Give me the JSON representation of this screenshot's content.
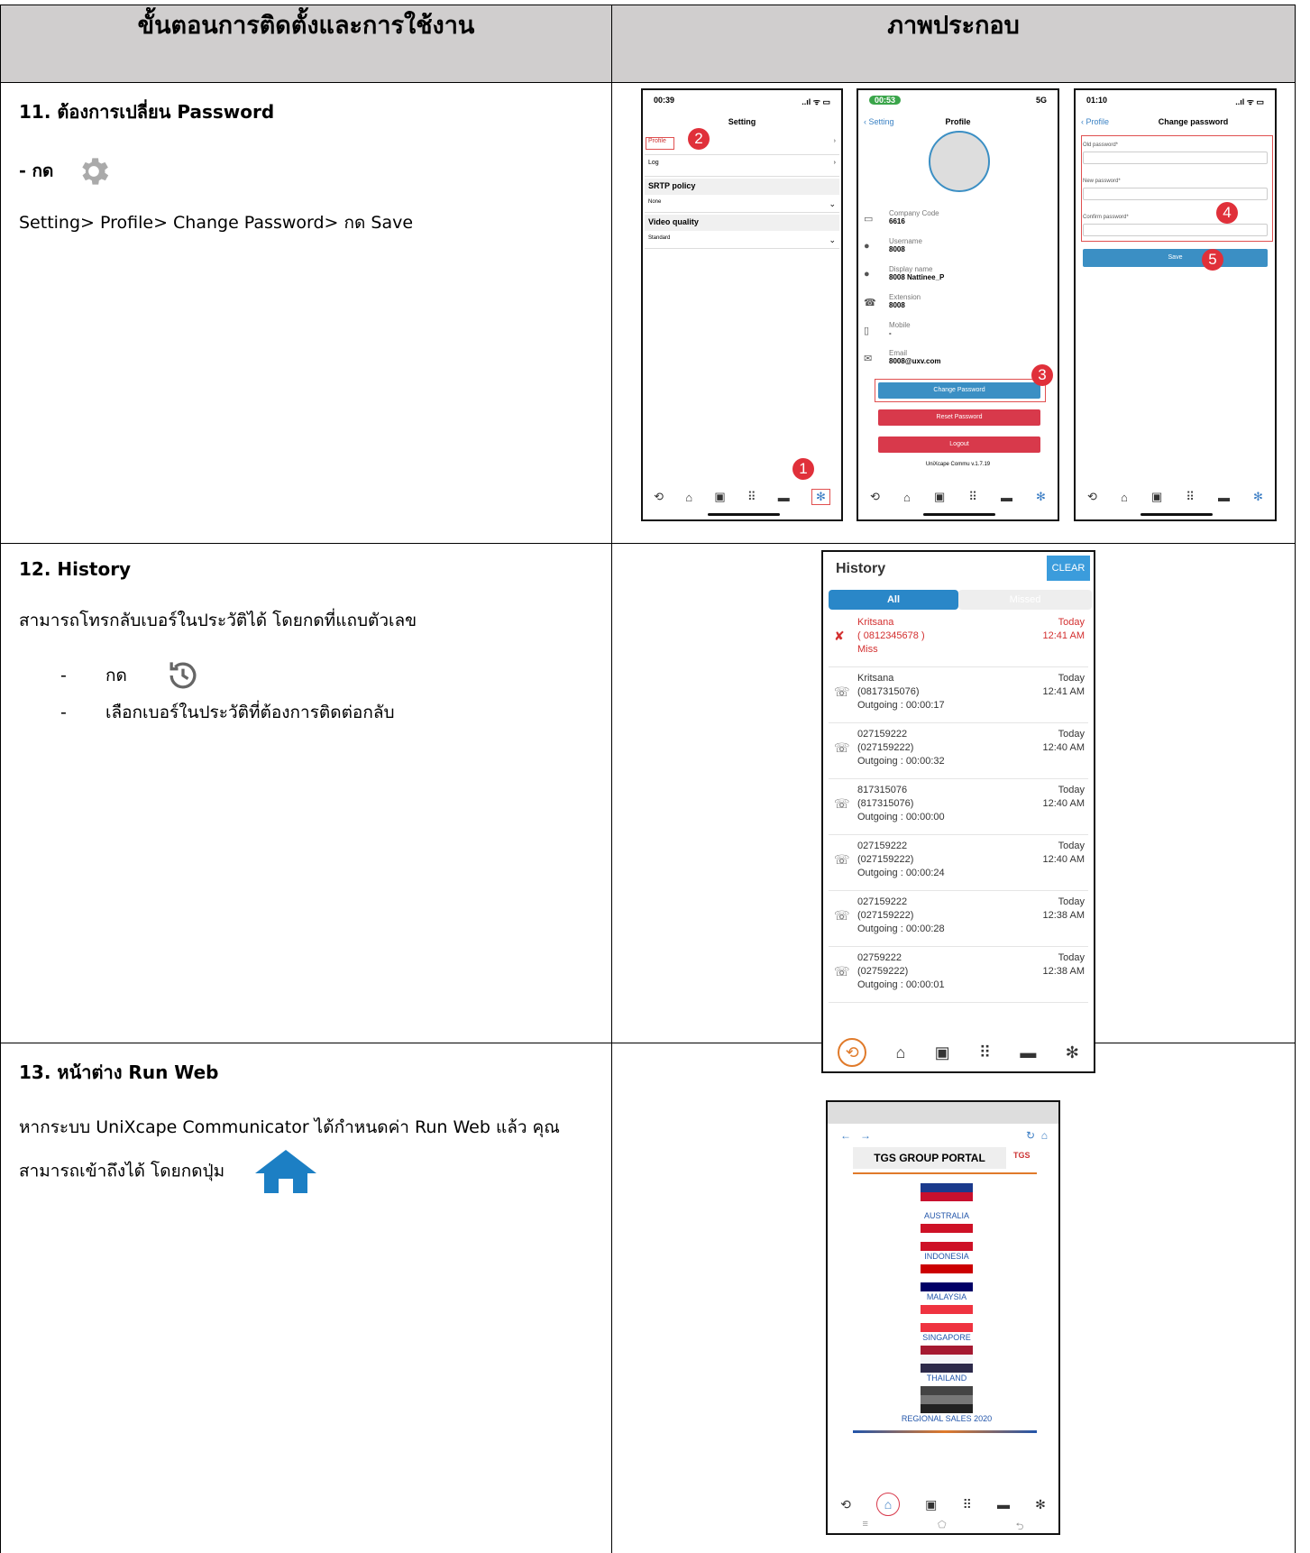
{
  "header": {
    "col1": "ขั้นตอนการติดตั้งและการใช้งาน",
    "col2": "ภาพประกอบ"
  },
  "step11": {
    "title": "11. ต้องการเปลี่ยน Password",
    "press": "- กด",
    "path": "Setting> Profile> Change Password> กด Save",
    "icon": "gear-icon"
  },
  "step12": {
    "title": "12.  History",
    "desc": "สามารถโทรกลับเบอร์ในประวัติได้ โดยกดที่แถบตัวเลข",
    "bullets": [
      {
        "dash": "-",
        "text": "กด"
      },
      {
        "dash": "-",
        "text": "เลือกเบอร์ในประวัติที่ต้องการติดต่อกลับ"
      }
    ],
    "icon": "history-icon"
  },
  "step13": {
    "title": "13. หน้าต่าง Run Web",
    "desc1": "หากระบบ UniXcape Communicator ได้กำหนดค่า Run Web แล้ว คุณ",
    "desc2": "สามารถเข้าถึงได้ โดยกดปุ่ม",
    "icon": "home-icon"
  },
  "phone1": {
    "time": "00:39",
    "signal": "..ıl ᯤ ▭",
    "title": "Setting",
    "items": [
      "Profile",
      "Log"
    ],
    "srtp_label": "SRTP policy",
    "srtp_value": "None",
    "video_label": "Video quality",
    "video_value": "Standard",
    "badge1": "1",
    "badge2": "2"
  },
  "phone2": {
    "time": "00:53",
    "signal": "5G",
    "back": "Setting",
    "title": "Profile",
    "fields": [
      {
        "label": "Company Code",
        "value": "6616"
      },
      {
        "label": "Username",
        "value": "8008"
      },
      {
        "label": "Display name",
        "value": "8008 Nattinee_P"
      },
      {
        "label": "Extension",
        "value": "8008"
      },
      {
        "label": "Mobile",
        "value": "-"
      },
      {
        "label": "Email",
        "value": "8008@uxv.com"
      }
    ],
    "btn_change": "Change Password",
    "btn_reset": "Reset Password",
    "btn_logout": "Logout",
    "version": "UniXcape Commu v.1.7.19",
    "badge3": "3"
  },
  "phone3": {
    "time": "01:10",
    "signal": "..ıl ᯤ ▭",
    "back": "Profile",
    "title": "Change password",
    "old": "Old password*",
    "new": "New password*",
    "confirm": "Confirm password*",
    "save": "Save",
    "badge4": "4",
    "badge5": "5"
  },
  "history": {
    "title": "History",
    "clear": "CLEAR",
    "tab_all": "All",
    "tab_missed": "Missed",
    "entries": [
      {
        "name": "Kritsana",
        "number": "( 0812345678 )",
        "status": "Miss",
        "day": "Today",
        "time": "12:41 AM",
        "missed": true
      },
      {
        "name": "Kritsana",
        "number": "(0817315076)",
        "status": "Outgoing : 00:00:17",
        "day": "Today",
        "time": "12:41 AM",
        "missed": false
      },
      {
        "name": "027159222",
        "number": "(027159222)",
        "status": "Outgoing : 00:00:32",
        "day": "Today",
        "time": "12:40 AM",
        "missed": false
      },
      {
        "name": "817315076",
        "number": "(817315076)",
        "status": "Outgoing : 00:00:00",
        "day": "Today",
        "time": "12:40 AM",
        "missed": false
      },
      {
        "name": "027159222",
        "number": "(027159222)",
        "status": "Outgoing : 00:00:24",
        "day": "Today",
        "time": "12:40 AM",
        "missed": false
      },
      {
        "name": "027159222",
        "number": "(027159222)",
        "status": "Outgoing : 00:00:28",
        "day": "Today",
        "time": "12:38 AM",
        "missed": false
      },
      {
        "name": "02759222",
        "number": "(02759222)",
        "status": "Outgoing : 00:00:01",
        "day": "Today",
        "time": "12:38 AM",
        "missed": false
      }
    ]
  },
  "portal": {
    "title": "TGS GROUP PORTAL",
    "logo": "TGS",
    "countries": [
      "AUSTRALIA",
      "INDONESIA",
      "MALAYSIA",
      "SINGAPORE",
      "THAILAND",
      "REGIONAL SALES 2020"
    ]
  },
  "colors": {
    "header_bg": "#d0cece",
    "accent": "#3b8fc4",
    "danger": "#d8394b",
    "badge": "#e0303a"
  }
}
